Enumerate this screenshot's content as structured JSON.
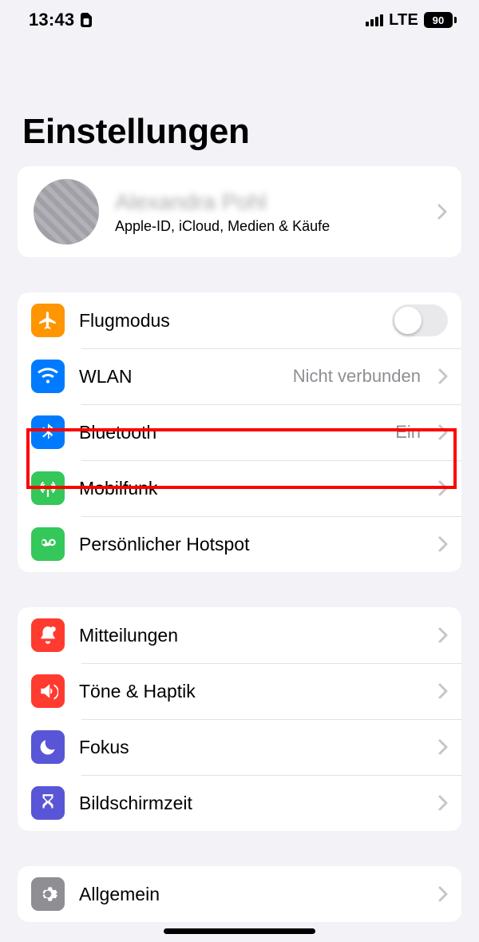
{
  "status": {
    "time": "13:43",
    "network": "LTE",
    "battery": "90"
  },
  "title": "Einstellungen",
  "profile": {
    "name": "Alexandra Pohl",
    "subtitle": "Apple-ID, iCloud, Medien & Käufe"
  },
  "groups": [
    {
      "items": [
        {
          "label": "Flugmodus",
          "value": "",
          "type": "toggle",
          "toggle_on": false
        },
        {
          "label": "WLAN",
          "value": "Nicht verbunden",
          "type": "link"
        },
        {
          "label": "Bluetooth",
          "value": "Ein",
          "type": "link"
        },
        {
          "label": "Mobilfunk",
          "value": "",
          "type": "link"
        },
        {
          "label": "Persönlicher Hotspot",
          "value": "",
          "type": "link"
        }
      ]
    },
    {
      "items": [
        {
          "label": "Mitteilungen",
          "value": "",
          "type": "link"
        },
        {
          "label": "Töne & Haptik",
          "value": "",
          "type": "link"
        },
        {
          "label": "Fokus",
          "value": "",
          "type": "link"
        },
        {
          "label": "Bildschirmzeit",
          "value": "",
          "type": "link"
        }
      ]
    },
    {
      "items": [
        {
          "label": "Allgemein",
          "value": "",
          "type": "link"
        }
      ]
    }
  ]
}
